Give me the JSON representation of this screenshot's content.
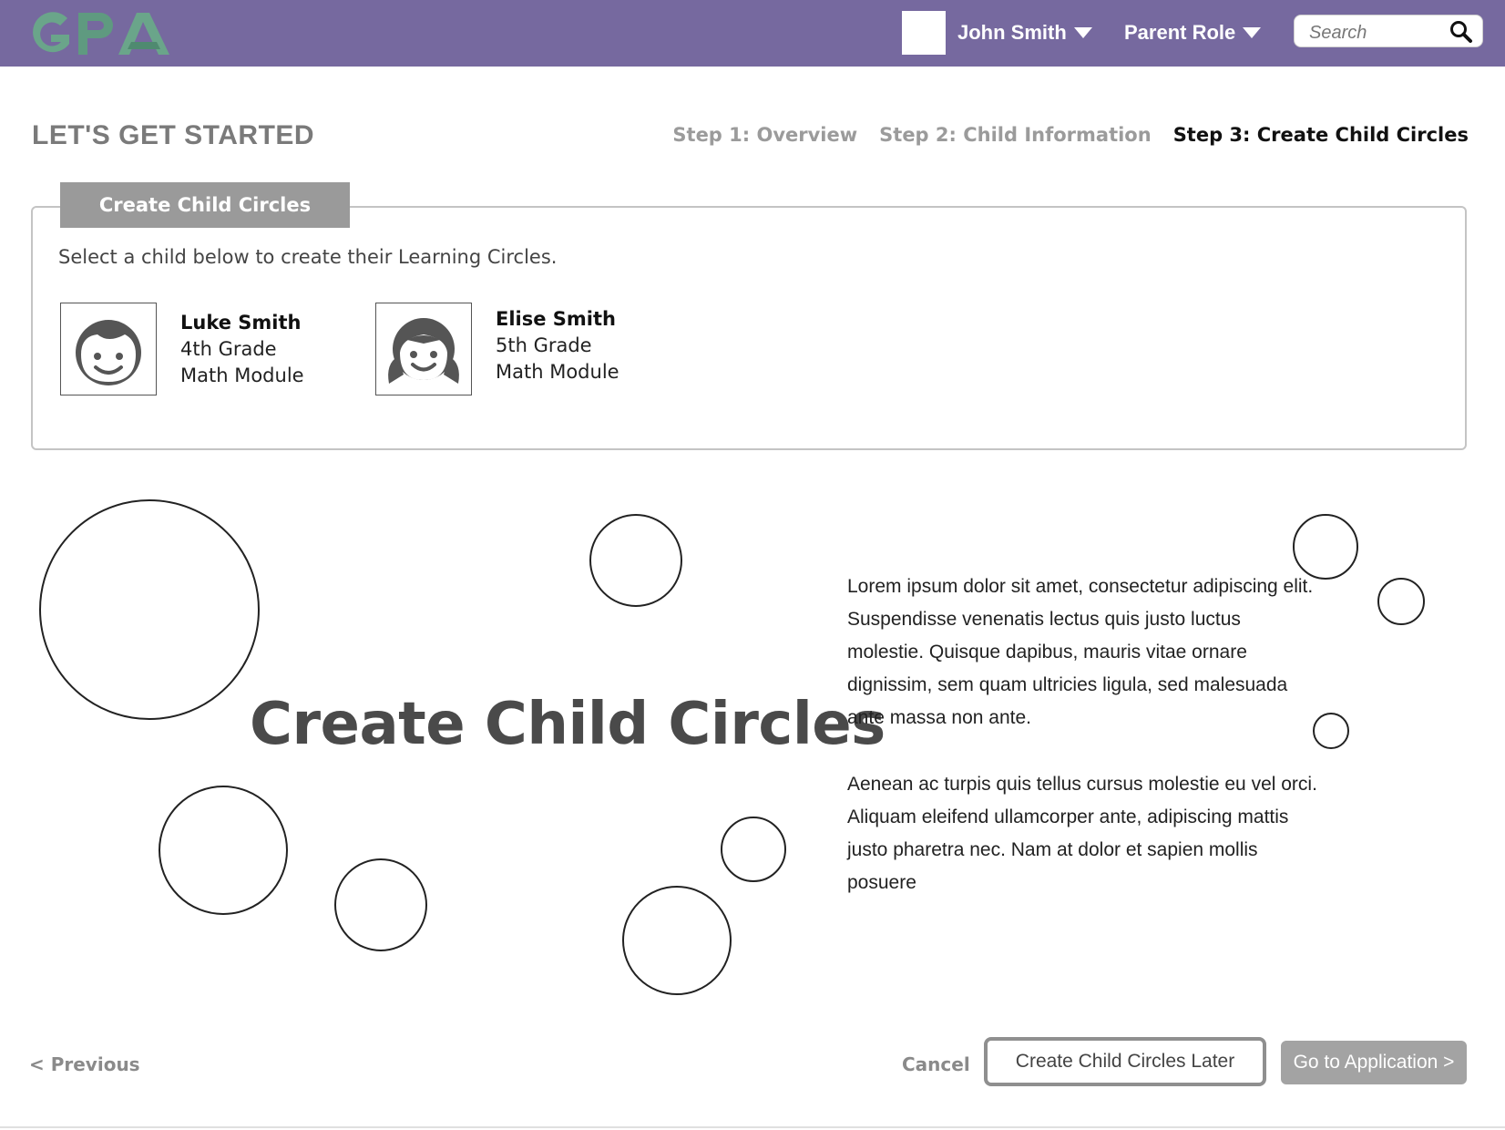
{
  "header": {
    "logo_text": "GPA",
    "user_name": "John Smith",
    "role": "Parent Role",
    "search_placeholder": "Search"
  },
  "page": {
    "title": "LET'S GET STARTED",
    "steps": [
      {
        "label": "Step 1: Overview",
        "active": false
      },
      {
        "label": "Step 2: Child Information",
        "active": false
      },
      {
        "label": "Step 3: Create Child Circles",
        "active": true
      }
    ]
  },
  "panel": {
    "tab_label": "Create Child Circles",
    "instruction": "Select a child below to create their Learning Circles.",
    "children": [
      {
        "name": "Luke Smith",
        "grade": "4th Grade",
        "module": "Math Module",
        "avatar": "boy-face-icon"
      },
      {
        "name": "Elise Smith",
        "grade": "5th Grade",
        "module": "Math Module",
        "avatar": "girl-face-icon"
      }
    ]
  },
  "hero": {
    "title": "Create Child Circles",
    "paragraphs": [
      "Lorem ipsum dolor sit amet, consectetur adipiscing elit. Suspendisse venenatis lectus quis justo luctus molestie. Quisque dapibus, mauris vitae ornare dignissim, sem quam ultricies ligula, sed malesuada ante massa non ante.",
      "Aenean ac turpis quis tellus cursus molestie eu vel orci. Aliquam eleifend ullamcorper ante, adipiscing mattis justo pharetra nec. Nam at dolor et sapien mollis posuere"
    ]
  },
  "footer": {
    "previous": "< Previous",
    "cancel": "Cancel",
    "later": "Create Child Circles Later",
    "go": "Go to Application >"
  },
  "colors": {
    "header_bg": "#76699f",
    "logo_green": "#6aa58a",
    "tab_bg": "#9a9a9a"
  }
}
